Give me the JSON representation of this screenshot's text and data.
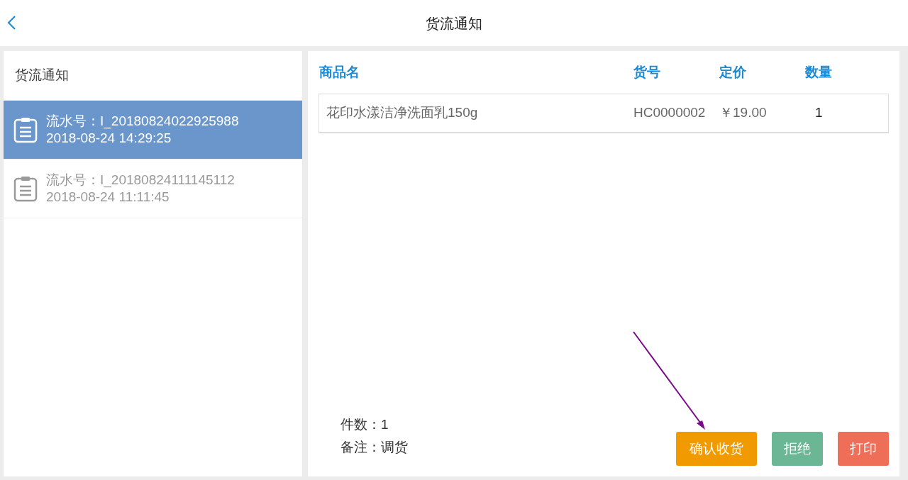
{
  "header": {
    "title": "货流通知"
  },
  "sidebar": {
    "title": "货流通知",
    "items": [
      {
        "serial": "流水号：I_20180824022925988",
        "time": "2018-08-24 14:29:25",
        "selected": true
      },
      {
        "serial": "流水号：I_20180824111145112",
        "time": "2018-08-24 11:11:45",
        "selected": false
      }
    ]
  },
  "table": {
    "columns": [
      "商品名",
      "货号",
      "定价",
      "数量"
    ],
    "rows": [
      [
        "花印水漾洁净洗面乳150g",
        "HC0000002",
        "￥19.00",
        "1"
      ]
    ]
  },
  "summary": [
    "件数：1",
    "备注：调货"
  ],
  "buttons": [
    {
      "label": "确认收货",
      "kind": "confirm"
    },
    {
      "label": "拒绝",
      "kind": "reject"
    },
    {
      "label": "打印",
      "kind": "print"
    }
  ]
}
